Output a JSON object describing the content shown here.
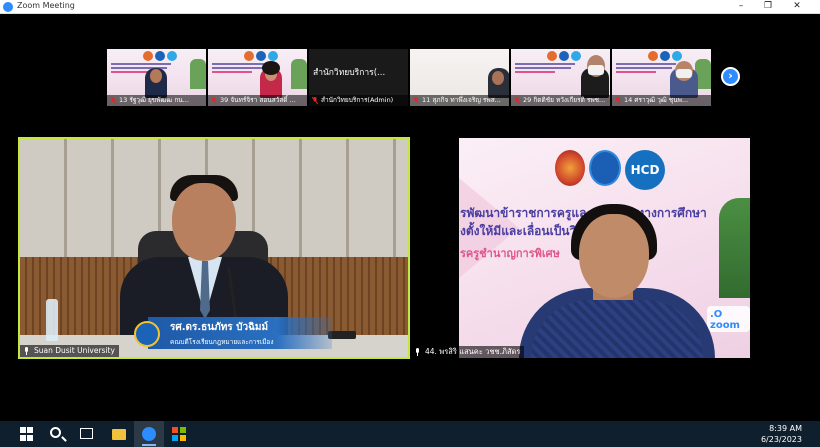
{
  "window": {
    "title": "Zoom Meeting",
    "controls": {
      "minimize": "–",
      "maximize": "❐",
      "close": "✕"
    }
  },
  "thumbnails": [
    {
      "name": "13 รัฐวุฒิ ยุขพัฒฒ กน...",
      "muted": true
    },
    {
      "name": "39 จันทร์จิรา สอนสวัสดิ์ ...",
      "muted": true
    },
    {
      "big_text": "สำนักวิทยบริการ(...",
      "name": "สำนักวิทยบริการ(Admin)",
      "muted": true
    },
    {
      "name": "11 สุภกิจ ทาพึ่งเจริญ รพส...",
      "muted": true
    },
    {
      "name": "29 กิตติชัย หวังเกียรติ รพช...",
      "muted": true
    },
    {
      "name": "14 ศราวุฒิ วุฒิ ชุนพ...",
      "muted": true
    }
  ],
  "next_page_icon": "chevron-right-icon",
  "main_videos": {
    "left": {
      "label": "Suan Dusit University",
      "speaker_name": "รศ.ดร.ธนภัทร บัวฉิมม์",
      "speaker_role": "คณบดีโรงเรียนกฎหมายและการเมือง",
      "active_speaker_color": "#c6e83c"
    },
    "right": {
      "label": "44. พรสิริ แสนคะ วชช.ภิสัดร",
      "slide_line1": "รพัฒนาข้าราชการครูและบุคลากรทางการศึกษา",
      "slide_line2": "งตั้งให้มีและเลื่อนเป็นวิ",
      "slide_line3": "รครูชำนาญการพิเศษ",
      "logo_text": "HCD",
      "badge_text": ".O\nzoom"
    }
  },
  "taskbar": {
    "icons": [
      "windows-start-icon",
      "search-icon",
      "task-view-icon",
      "file-explorer-icon",
      "zoom-app-icon",
      "microsoft-store-icon"
    ],
    "time": "8:39 AM",
    "date": "6/23/2023"
  }
}
